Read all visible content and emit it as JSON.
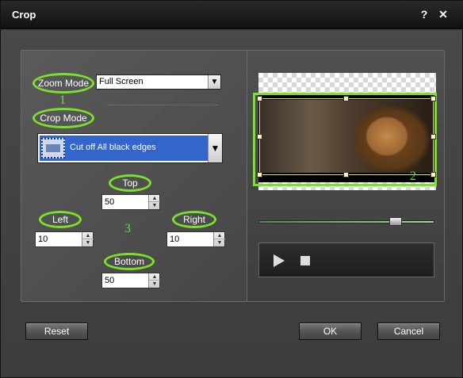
{
  "window": {
    "title": "Crop",
    "help_label": "?",
    "close_label": "✕"
  },
  "zoom": {
    "label": "Zoom Mode",
    "value": "Full Screen",
    "annotation": "1"
  },
  "crop_mode": {
    "label": "Crop Mode",
    "value": "Cut off All black edges",
    "icon": "film-frame-icon"
  },
  "margins": {
    "top": {
      "label": "Top",
      "value": "50"
    },
    "left": {
      "label": "Left",
      "value": "10"
    },
    "right": {
      "label": "Right",
      "value": "10"
    },
    "bottom": {
      "label": "Bottom",
      "value": "50"
    },
    "annotation": "3"
  },
  "preview": {
    "annotation": "2",
    "seek_position": 0.8
  },
  "buttons": {
    "reset": "Reset",
    "ok": "OK",
    "cancel": "Cancel"
  },
  "colors": {
    "highlight": "#7be02a",
    "annotation_text": "#5ee43a",
    "selection_blue": "#3366cc"
  }
}
